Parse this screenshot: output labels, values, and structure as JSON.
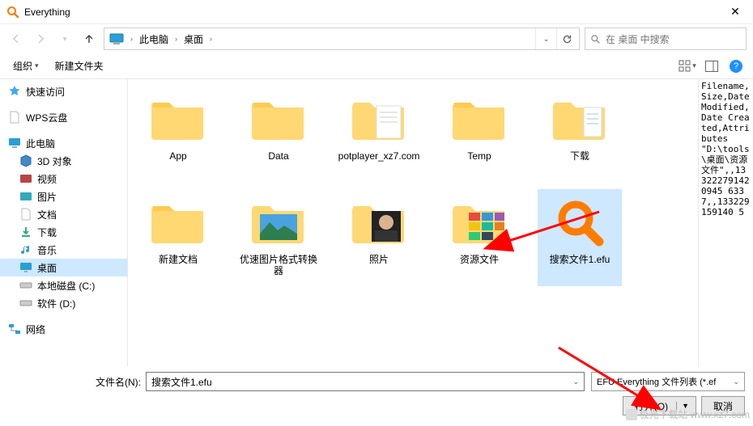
{
  "window": {
    "title": "Everything"
  },
  "nav": {
    "crumbs": [
      "此电脑",
      "桌面"
    ],
    "search_placeholder": "在 桌面 中搜索"
  },
  "toolbar": {
    "organize": "组织",
    "new_folder": "新建文件夹"
  },
  "sidebar": {
    "quick_access": "快速访问",
    "wps": "WPS云盘",
    "this_pc": "此电脑",
    "children": [
      {
        "label": "3D 对象"
      },
      {
        "label": "视频"
      },
      {
        "label": "图片"
      },
      {
        "label": "文档"
      },
      {
        "label": "下载"
      },
      {
        "label": "音乐"
      },
      {
        "label": "桌面",
        "selected": true
      },
      {
        "label": "本地磁盘 (C:)"
      },
      {
        "label": "软件 (D:)"
      }
    ],
    "network": "网络"
  },
  "files": {
    "row1": [
      {
        "label": "App",
        "type": "folder"
      },
      {
        "label": "Data",
        "type": "folder"
      },
      {
        "label": "potplayer_xz7.com",
        "type": "folder-open"
      },
      {
        "label": "Temp",
        "type": "folder"
      },
      {
        "label": "下载",
        "type": "folder-doc"
      },
      {
        "label": "新建文档",
        "type": "folder"
      }
    ],
    "row2": [
      {
        "label": "优速图片格式转换器",
        "type": "folder-photo-sky"
      },
      {
        "label": "照片",
        "type": "folder-photo-face"
      },
      {
        "label": "资源文件",
        "type": "folder-thumbs"
      },
      {
        "label": "搜索文件1.efu",
        "type": "efu",
        "selected": true
      }
    ]
  },
  "preview_text": "Filename,Size,Date Modified,Date Created,Attributes\n\"D:\\tools\\桌面\\资源文件\",,133222791420945 6337,,133229159140 5",
  "bottom": {
    "filename_label": "文件名(N):",
    "filename_value": "搜索文件1.efu",
    "filter_label": "EFU Everything 文件列表 (*.ef",
    "open": "打开(O)",
    "cancel": "取消"
  },
  "watermark": "极光下载站 www.xz7.com"
}
